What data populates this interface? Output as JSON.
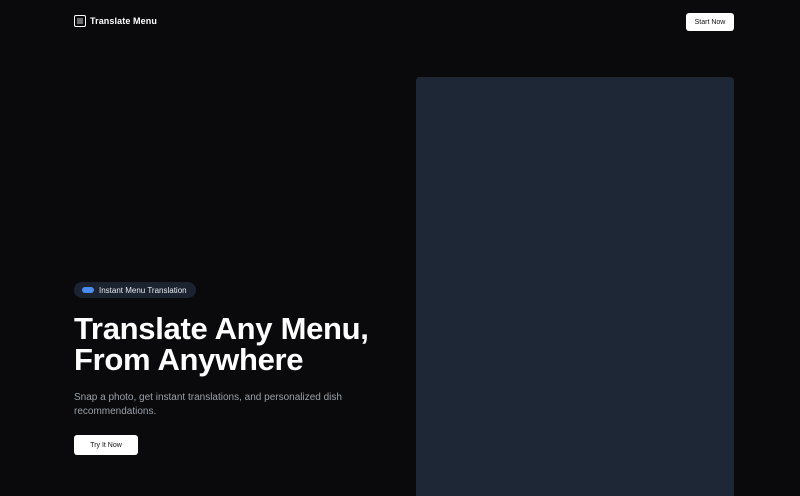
{
  "header": {
    "brand_name": "Translate Menu",
    "logo_icon": "utensils-icon",
    "start_button_label": "Start Now"
  },
  "hero": {
    "badge_text": "Instant Menu Translation",
    "title_line1": "Translate Any Menu,",
    "title_line2": "From Anywhere",
    "subtitle": "Snap a photo, get instant translations, and personalized dish recommendations.",
    "cta_label": "Try It Now"
  },
  "colors": {
    "background": "#0a0a0c",
    "panel": "#1e2735",
    "badge_bg": "#1b2330",
    "accent": "#4a8df0",
    "button_bg": "#ffffff",
    "muted_text": "#9aa0a8"
  }
}
